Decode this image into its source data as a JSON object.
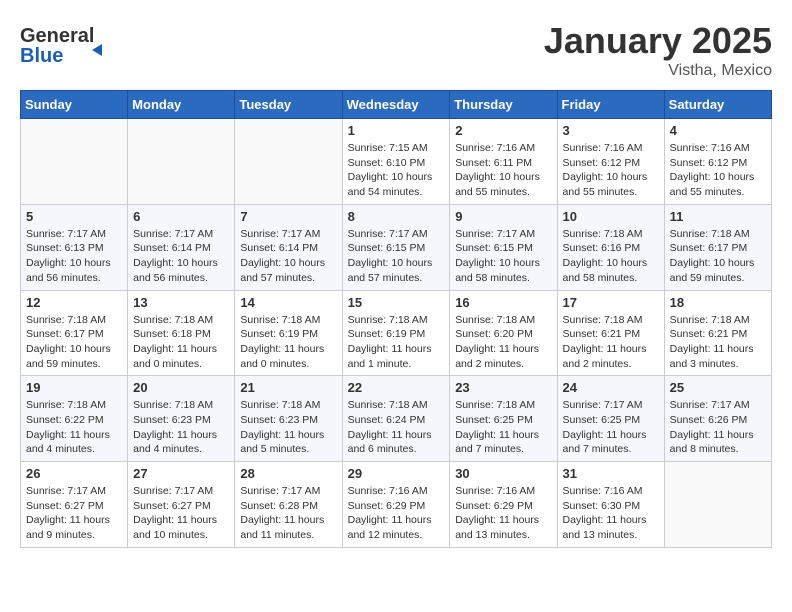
{
  "logo": {
    "line1": "General",
    "line2": "Blue"
  },
  "title": "January 2025",
  "subtitle": "Vistha, Mexico",
  "days_of_week": [
    "Sunday",
    "Monday",
    "Tuesday",
    "Wednesday",
    "Thursday",
    "Friday",
    "Saturday"
  ],
  "weeks": [
    [
      {
        "day": "",
        "info": ""
      },
      {
        "day": "",
        "info": ""
      },
      {
        "day": "",
        "info": ""
      },
      {
        "day": "1",
        "info": "Sunrise: 7:15 AM\nSunset: 6:10 PM\nDaylight: 10 hours\nand 54 minutes."
      },
      {
        "day": "2",
        "info": "Sunrise: 7:16 AM\nSunset: 6:11 PM\nDaylight: 10 hours\nand 55 minutes."
      },
      {
        "day": "3",
        "info": "Sunrise: 7:16 AM\nSunset: 6:12 PM\nDaylight: 10 hours\nand 55 minutes."
      },
      {
        "day": "4",
        "info": "Sunrise: 7:16 AM\nSunset: 6:12 PM\nDaylight: 10 hours\nand 55 minutes."
      }
    ],
    [
      {
        "day": "5",
        "info": "Sunrise: 7:17 AM\nSunset: 6:13 PM\nDaylight: 10 hours\nand 56 minutes."
      },
      {
        "day": "6",
        "info": "Sunrise: 7:17 AM\nSunset: 6:14 PM\nDaylight: 10 hours\nand 56 minutes."
      },
      {
        "day": "7",
        "info": "Sunrise: 7:17 AM\nSunset: 6:14 PM\nDaylight: 10 hours\nand 57 minutes."
      },
      {
        "day": "8",
        "info": "Sunrise: 7:17 AM\nSunset: 6:15 PM\nDaylight: 10 hours\nand 57 minutes."
      },
      {
        "day": "9",
        "info": "Sunrise: 7:17 AM\nSunset: 6:15 PM\nDaylight: 10 hours\nand 58 minutes."
      },
      {
        "day": "10",
        "info": "Sunrise: 7:18 AM\nSunset: 6:16 PM\nDaylight: 10 hours\nand 58 minutes."
      },
      {
        "day": "11",
        "info": "Sunrise: 7:18 AM\nSunset: 6:17 PM\nDaylight: 10 hours\nand 59 minutes."
      }
    ],
    [
      {
        "day": "12",
        "info": "Sunrise: 7:18 AM\nSunset: 6:17 PM\nDaylight: 10 hours\nand 59 minutes."
      },
      {
        "day": "13",
        "info": "Sunrise: 7:18 AM\nSunset: 6:18 PM\nDaylight: 11 hours\nand 0 minutes."
      },
      {
        "day": "14",
        "info": "Sunrise: 7:18 AM\nSunset: 6:19 PM\nDaylight: 11 hours\nand 0 minutes."
      },
      {
        "day": "15",
        "info": "Sunrise: 7:18 AM\nSunset: 6:19 PM\nDaylight: 11 hours\nand 1 minute."
      },
      {
        "day": "16",
        "info": "Sunrise: 7:18 AM\nSunset: 6:20 PM\nDaylight: 11 hours\nand 2 minutes."
      },
      {
        "day": "17",
        "info": "Sunrise: 7:18 AM\nSunset: 6:21 PM\nDaylight: 11 hours\nand 2 minutes."
      },
      {
        "day": "18",
        "info": "Sunrise: 7:18 AM\nSunset: 6:21 PM\nDaylight: 11 hours\nand 3 minutes."
      }
    ],
    [
      {
        "day": "19",
        "info": "Sunrise: 7:18 AM\nSunset: 6:22 PM\nDaylight: 11 hours\nand 4 minutes."
      },
      {
        "day": "20",
        "info": "Sunrise: 7:18 AM\nSunset: 6:23 PM\nDaylight: 11 hours\nand 4 minutes."
      },
      {
        "day": "21",
        "info": "Sunrise: 7:18 AM\nSunset: 6:23 PM\nDaylight: 11 hours\nand 5 minutes."
      },
      {
        "day": "22",
        "info": "Sunrise: 7:18 AM\nSunset: 6:24 PM\nDaylight: 11 hours\nand 6 minutes."
      },
      {
        "day": "23",
        "info": "Sunrise: 7:18 AM\nSunset: 6:25 PM\nDaylight: 11 hours\nand 7 minutes."
      },
      {
        "day": "24",
        "info": "Sunrise: 7:17 AM\nSunset: 6:25 PM\nDaylight: 11 hours\nand 7 minutes."
      },
      {
        "day": "25",
        "info": "Sunrise: 7:17 AM\nSunset: 6:26 PM\nDaylight: 11 hours\nand 8 minutes."
      }
    ],
    [
      {
        "day": "26",
        "info": "Sunrise: 7:17 AM\nSunset: 6:27 PM\nDaylight: 11 hours\nand 9 minutes."
      },
      {
        "day": "27",
        "info": "Sunrise: 7:17 AM\nSunset: 6:27 PM\nDaylight: 11 hours\nand 10 minutes."
      },
      {
        "day": "28",
        "info": "Sunrise: 7:17 AM\nSunset: 6:28 PM\nDaylight: 11 hours\nand 11 minutes."
      },
      {
        "day": "29",
        "info": "Sunrise: 7:16 AM\nSunset: 6:29 PM\nDaylight: 11 hours\nand 12 minutes."
      },
      {
        "day": "30",
        "info": "Sunrise: 7:16 AM\nSunset: 6:29 PM\nDaylight: 11 hours\nand 13 minutes."
      },
      {
        "day": "31",
        "info": "Sunrise: 7:16 AM\nSunset: 6:30 PM\nDaylight: 11 hours\nand 13 minutes."
      },
      {
        "day": "",
        "info": ""
      }
    ]
  ]
}
